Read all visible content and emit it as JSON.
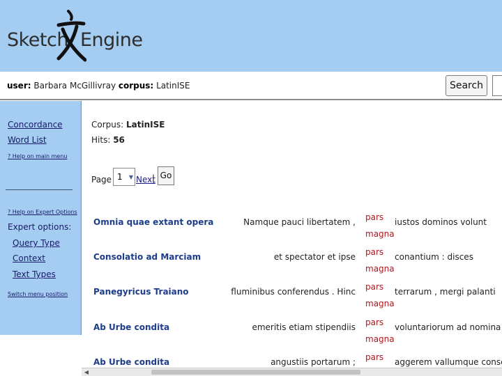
{
  "header": {
    "logo_left": "Sketch",
    "logo_right": "Engine",
    "background_color": "#a4cdf1"
  },
  "userbar": {
    "user_label": "user:",
    "user_name": "Barbara McGillivray",
    "corpus_label": "corpus:",
    "corpus_name": "LatinISE",
    "search_button": "Search"
  },
  "sidebar": {
    "concordance": "Concordance",
    "word_list": "Word List",
    "help_main": "? Help on main menu",
    "help_expert": "? Help on Expert Options",
    "expert_options": "Expert options:",
    "query_type": "Query Type",
    "context": "Context",
    "text_types": "Text Types",
    "switch_menu": "Switch menu position"
  },
  "main": {
    "corpus_label": "Corpus:",
    "corpus_value": "LatinISE",
    "hits_label": "Hits:",
    "hits_value": "56",
    "page_label": "Page",
    "page_value": "1",
    "next_label": "Next",
    "separator": "|",
    "go_button": "Go"
  },
  "results": [
    {
      "title": "Omnia quae extant opera",
      "left": "Namque pauci libertatem ,",
      "kwic1": "pars",
      "kwic2": "magna",
      "right": "iustos dominos volunt"
    },
    {
      "title": "Consolatio ad Marciam",
      "left": "et spectator et ipse",
      "kwic1": "pars",
      "kwic2": "magna",
      "right": "conantium : disces"
    },
    {
      "title": "Panegyricus Traiano",
      "left": "fluminibus conferendus . Hinc",
      "kwic1": "pars",
      "kwic2": "magna",
      "right": "terrarum , mergi palanti"
    },
    {
      "title": "Ab Urbe condita",
      "left": "emeritis etiam stipendiis",
      "kwic1": "pars",
      "kwic2": "magna",
      "right": "voluntariorum ad nomina"
    },
    {
      "title": "Ab Urbe condita",
      "left": "angustiis portarum ;",
      "kwic1": "pars",
      "kwic2": "",
      "right": "aggerem vallumque conscendit"
    }
  ],
  "colors": {
    "title_link": "#1d3c8c",
    "kwic": "#b4141c",
    "sidebar_link": "#1a1a6a"
  }
}
